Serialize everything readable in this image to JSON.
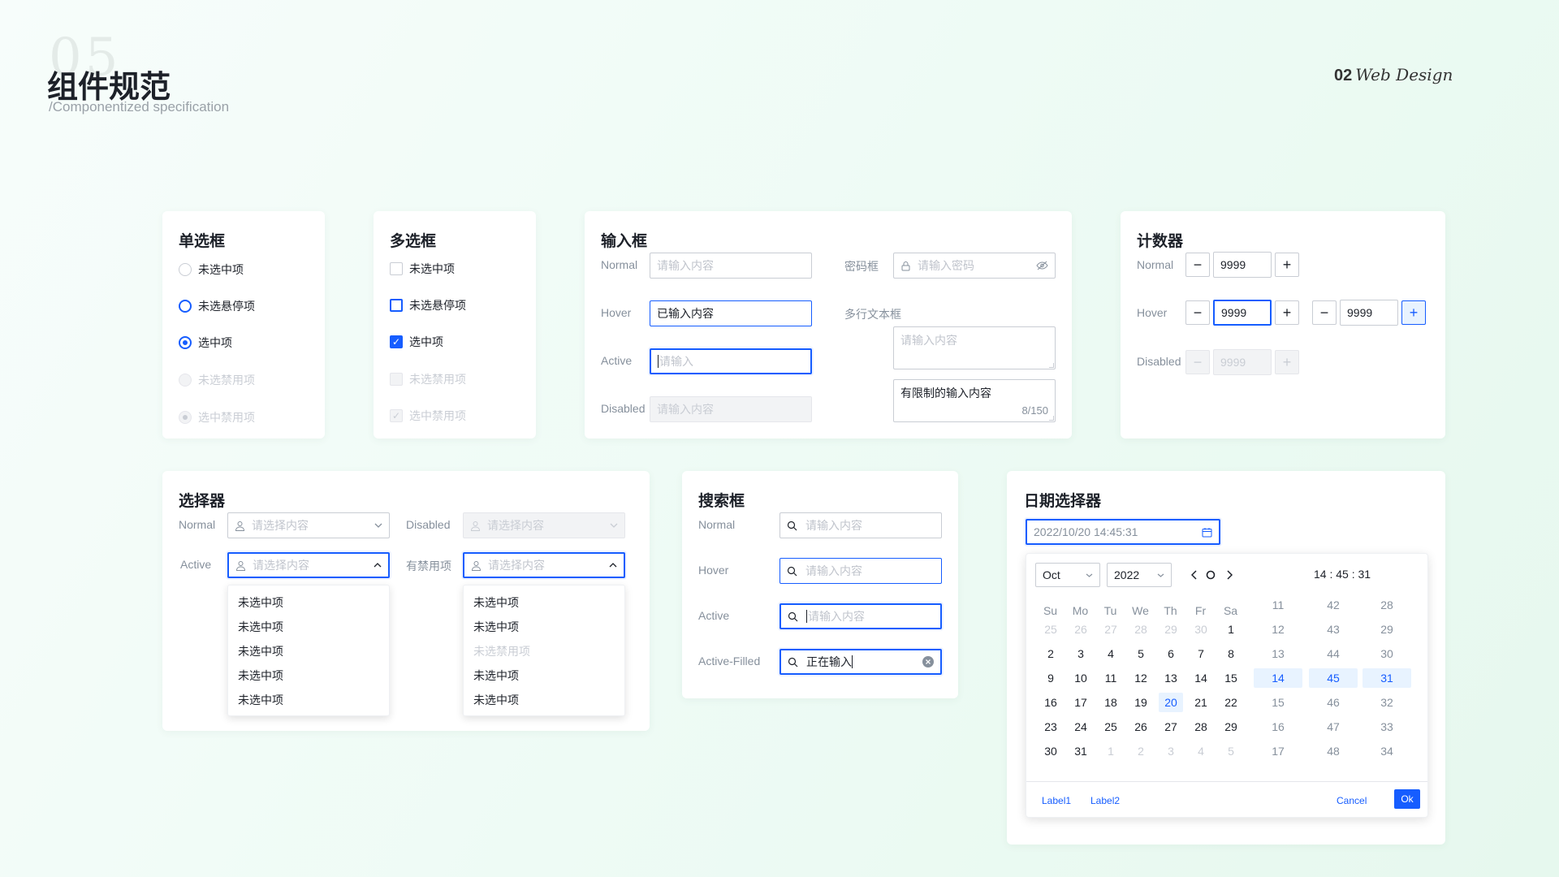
{
  "page": {
    "ghost_number": "05",
    "title": "组件规范",
    "subtitle": "/Componentized specification",
    "brand_num": "02",
    "brand_text": "Web Design"
  },
  "radio": {
    "title": "单选框",
    "items": [
      "未选中项",
      "未选悬停项",
      "选中项",
      "未选禁用项",
      "选中禁用项"
    ]
  },
  "checkbox": {
    "title": "多选框",
    "items": [
      "未选中项",
      "未选悬停项",
      "选中项",
      "未选禁用项",
      "选中禁用项"
    ]
  },
  "input": {
    "title": "输入框",
    "labels": [
      "Normal",
      "Hover",
      "Active",
      "Disabled"
    ],
    "normal_placeholder": "请输入内容",
    "hover_value": "已输入内容",
    "active_placeholder": "请输入",
    "disabled_placeholder": "请输入内容",
    "password_label": "密码框",
    "password_placeholder": "请输入密码",
    "textarea_label": "多行文本框",
    "textarea_placeholder": "请输入内容",
    "limited_value": "有限制的输入内容",
    "limited_count": "8/150"
  },
  "counter": {
    "title": "计数器",
    "labels": [
      "Normal",
      "Hover",
      "Disabled"
    ],
    "value": "9999"
  },
  "select": {
    "title": "选择器",
    "labels": [
      "Normal",
      "Disabled",
      "Active",
      "有禁用项"
    ],
    "placeholder": "请选择内容",
    "list1": [
      "未选中项",
      "未选中项",
      "未选中项",
      "未选中项",
      "未选中项"
    ],
    "list2": [
      "未选中项",
      "未选中项",
      "未选禁用项",
      "未选中项",
      "未选中项"
    ]
  },
  "search": {
    "title": "搜索框",
    "labels": [
      "Normal",
      "Hover",
      "Active",
      "Active-Filled"
    ],
    "placeholder": "请输入内容",
    "filled_value": "正在输入"
  },
  "datepicker": {
    "title": "日期选择器",
    "value": "2022/10/20 14:45:31",
    "month": "Oct",
    "year": "2022",
    "time": "14 : 45 : 31",
    "weekdays": [
      "Su",
      "Mo",
      "Tu",
      "We",
      "Th",
      "Fr",
      "Sa"
    ],
    "days": [
      [
        "25",
        "26",
        "27",
        "28",
        "29",
        "30",
        "1"
      ],
      [
        "2",
        "3",
        "4",
        "5",
        "6",
        "7",
        "8"
      ],
      [
        "9",
        "10",
        "11",
        "12",
        "13",
        "14",
        "15"
      ],
      [
        "16",
        "17",
        "18",
        "19",
        "20",
        "21",
        "22"
      ],
      [
        "23",
        "24",
        "25",
        "26",
        "27",
        "28",
        "29"
      ],
      [
        "30",
        "31",
        "1",
        "2",
        "3",
        "4",
        "5"
      ]
    ],
    "hours": [
      "11",
      "12",
      "13",
      "14",
      "15",
      "16",
      "17"
    ],
    "minutes": [
      "42",
      "43",
      "44",
      "45",
      "46",
      "47",
      "48"
    ],
    "seconds": [
      "28",
      "29",
      "30",
      "31",
      "32",
      "33",
      "34"
    ],
    "label1": "Label1",
    "label2": "Label2",
    "cancel": "Cancel",
    "ok": "Ok",
    "primary_color": "#165dff",
    "selected_bg": "#e8f3ff"
  }
}
